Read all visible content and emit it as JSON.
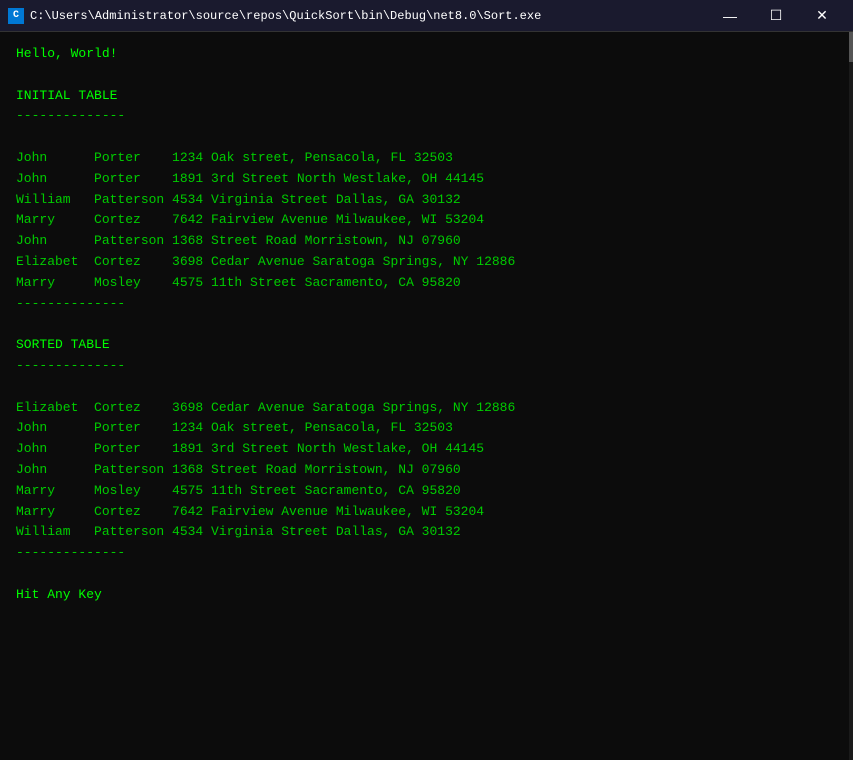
{
  "titlebar": {
    "icon_label": "C",
    "title": "C:\\Users\\Administrator\\source\\repos\\QuickSort\\bin\\Debug\\net8.0\\Sort.exe",
    "minimize_label": "—",
    "maximize_label": "☐",
    "close_label": "✕"
  },
  "console": {
    "hello_line": "Hello, World!",
    "initial_table_label": "INITIAL TABLE",
    "separator": "--------------",
    "initial_rows": [
      "John      Porter    1234 Oak street, Pensacola, FL 32503",
      "John      Porter    1891 3rd Street North Westlake, OH 44145",
      "William   Patterson 4534 Virginia Street Dallas, GA 30132",
      "Marry     Cortez    7642 Fairview Avenue Milwaukee, WI 53204",
      "John      Patterson 1368 Street Road Morristown, NJ 07960",
      "Elizabet  Cortez    3698 Cedar Avenue Saratoga Springs, NY 12886",
      "Marry     Mosley    4575 11th Street Sacramento, CA 95820"
    ],
    "sorted_table_label": "SORTED TABLE",
    "sorted_rows": [
      "Elizabet  Cortez    3698 Cedar Avenue Saratoga Springs, NY 12886",
      "John      Porter    1234 Oak street, Pensacola, FL 32503",
      "John      Porter    1891 3rd Street North Westlake, OH 44145",
      "John      Patterson 1368 Street Road Morristown, NJ 07960",
      "Marry     Mosley    4575 11th Street Sacramento, CA 95820",
      "Marry     Cortez    7642 Fairview Avenue Milwaukee, WI 53204",
      "William   Patterson 4534 Virginia Street Dallas, GA 30132"
    ],
    "hit_any_key": "Hit Any Key"
  }
}
